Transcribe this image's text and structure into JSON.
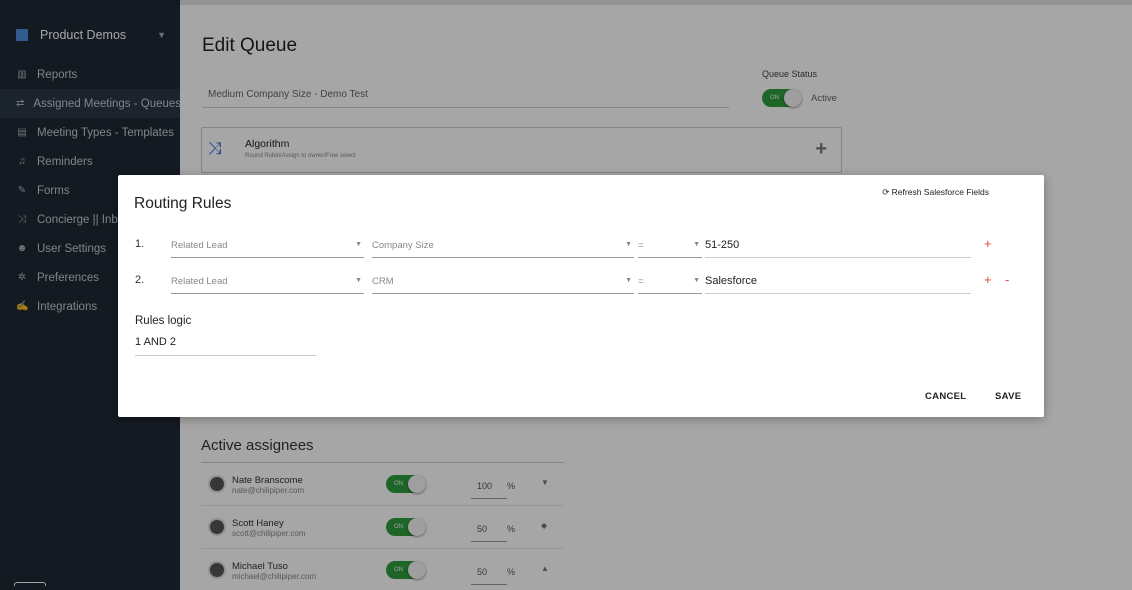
{
  "sidebar": {
    "brand": "Product Demos",
    "items": [
      {
        "label": "Reports",
        "icon": "bar-chart-icon",
        "glyph": "▥"
      },
      {
        "label": "Assigned Meetings - Queues",
        "icon": "swap-arrows-icon",
        "glyph": "⇄"
      },
      {
        "label": "Meeting Types - Templates",
        "icon": "calendar-icon",
        "glyph": "▤"
      },
      {
        "label": "Reminders",
        "icon": "bell-icon",
        "glyph": "♫"
      },
      {
        "label": "Forms",
        "icon": "edit-icon",
        "glyph": "✎"
      },
      {
        "label": "Concierge || Inbound",
        "icon": "shuffle-icon",
        "glyph": "⤨"
      },
      {
        "label": "User Settings",
        "icon": "users-icon",
        "glyph": "☻"
      },
      {
        "label": "Preferences",
        "icon": "gear-icon",
        "glyph": "✲"
      },
      {
        "label": "Integrations",
        "icon": "plug-icon",
        "glyph": "✍"
      }
    ]
  },
  "edit_queue": {
    "title": "Edit Queue",
    "queue_name_value": "Medium Company Size - Demo Test",
    "status_label": "Queue Status",
    "status_toggle": "ON",
    "status_value": "Active",
    "algorithm": {
      "title": "Algorithm",
      "description": "Round Robin/Assign to owner/Free select",
      "add": "+"
    }
  },
  "assignees": {
    "title": "Active assignees",
    "rows": [
      {
        "name": "Nate Branscome",
        "email": "nate@chilipiper.com",
        "toggle": "ON",
        "percent": "100",
        "pct_sign": "%",
        "arrow": "▼"
      },
      {
        "name": "Scott Haney",
        "email": "scott@chilipiper.com",
        "toggle": "ON",
        "percent": "50",
        "pct_sign": "%",
        "arrow": "◆"
      },
      {
        "name": "Michael Tuso",
        "email": "michael@chilipiper.com",
        "toggle": "ON",
        "percent": "50",
        "pct_sign": "%",
        "arrow": "▲"
      }
    ]
  },
  "modal": {
    "title": "Routing Rules",
    "refresh": "⟳ Refresh Salesforce Fields",
    "rules": [
      {
        "num": "1.",
        "object": "Related Lead",
        "field": "Company Size",
        "operator": "=",
        "value": "51-250",
        "plus": "+",
        "minus": ""
      },
      {
        "num": "2.",
        "object": "Related Lead",
        "field": "CRM",
        "operator": "=",
        "value": "Salesforce",
        "plus": "+",
        "minus": "-"
      }
    ],
    "logic_label": "Rules logic",
    "logic_value": "1 AND 2",
    "cancel": "CANCEL",
    "save": "SAVE"
  }
}
